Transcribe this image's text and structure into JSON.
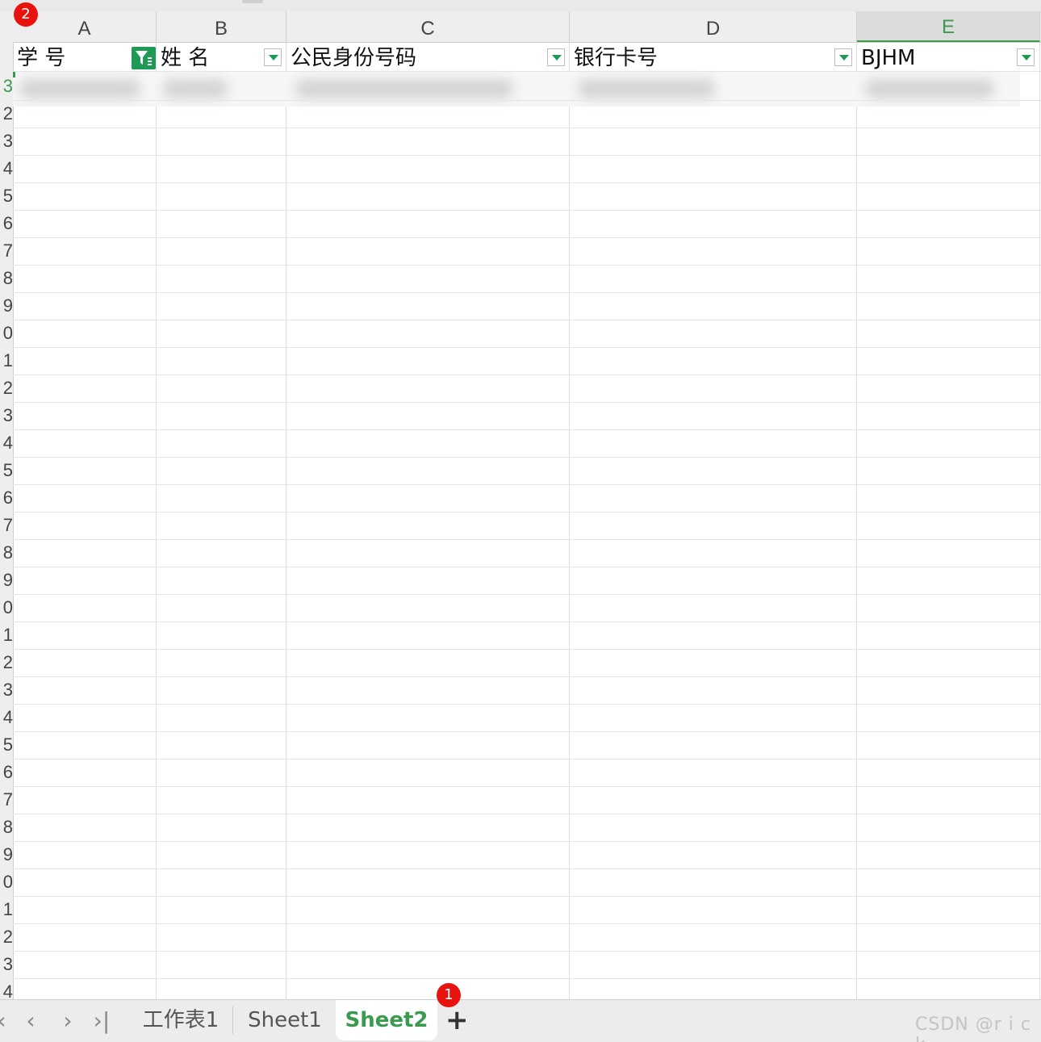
{
  "columns": [
    {
      "letter": "A"
    },
    {
      "letter": "B"
    },
    {
      "letter": "C"
    },
    {
      "letter": "D"
    },
    {
      "letter": "E"
    }
  ],
  "header_row": {
    "cells": [
      "学  号",
      "姓 名",
      "公民身份号码",
      "银行卡号",
      "BJHM"
    ],
    "filter_applied_column": "A"
  },
  "row_numbers": [
    "3",
    "2",
    "3",
    "4",
    "5",
    "6",
    "7",
    "8",
    "9",
    "0",
    "1",
    "2",
    "3",
    "4",
    "5",
    "6",
    "7",
    "8",
    "9",
    "0",
    "1",
    "2",
    "3",
    "4",
    "5",
    "6",
    "7",
    "8",
    "9",
    "0",
    "1",
    "2",
    "3",
    "4"
  ],
  "sheet_tabs": {
    "nav": [
      "first-sheet",
      "previous-sheet",
      "next-sheet",
      "last-sheet"
    ],
    "tabs": [
      "工作表1",
      "Sheet1",
      "Sheet2"
    ],
    "active_tab": "Sheet2",
    "add_label": "+"
  },
  "badges": {
    "first": "1",
    "second": "2"
  },
  "watermark": "CSDN @r i c k",
  "colors": {
    "accent": "#3a9a4e",
    "filter": "#1f9a55",
    "badge": "#e8130f"
  }
}
